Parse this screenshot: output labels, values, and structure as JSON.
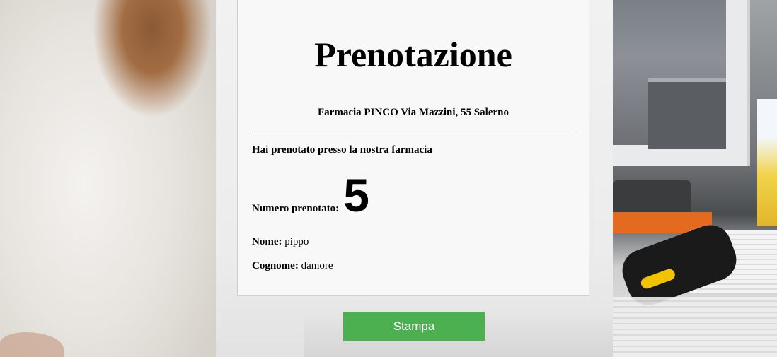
{
  "page": {
    "title": "Prenotazione",
    "pharmacy_address": "Farmacia PINCO Via Mazzini, 55 Salerno",
    "confirmation_message": "Hai prenotato presso la nostra farmacia"
  },
  "booking": {
    "number_label": "Numero prenotato:",
    "number_value": "5",
    "name_label": "Nome:",
    "name_value": "pippo",
    "surname_label": "Cognome:",
    "surname_value": "damore"
  },
  "actions": {
    "print_label": "Stampa"
  },
  "colors": {
    "print_button_bg": "#4caf50",
    "card_bg": "#f8f8f8"
  }
}
